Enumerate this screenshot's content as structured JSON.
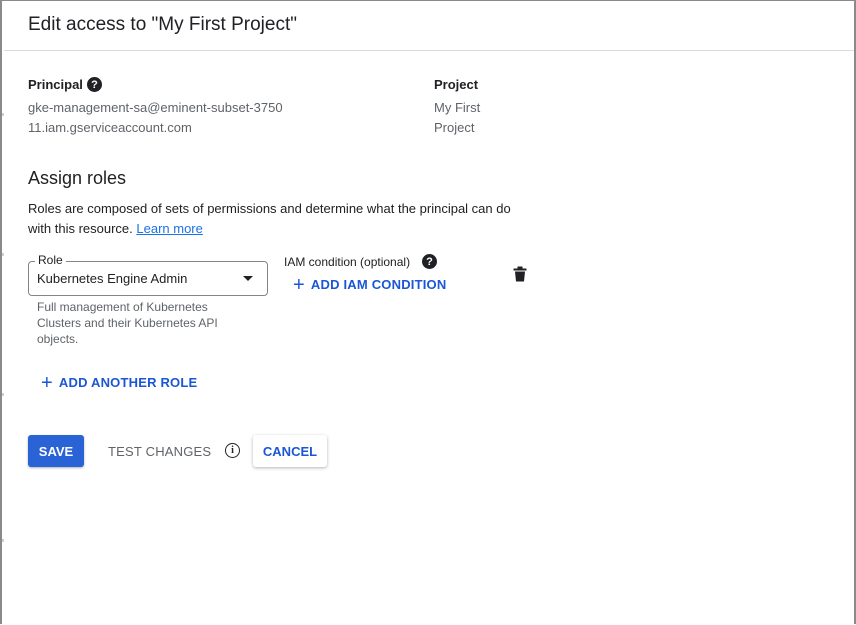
{
  "dialog": {
    "title": "Edit access to \"My First Project\""
  },
  "principal": {
    "label": "Principal",
    "help_icon": "help-circle-icon",
    "value": "gke-management-sa@eminent-subset-375011.iam.gserviceaccount.com"
  },
  "project": {
    "label": "Project",
    "value": "My First Project"
  },
  "assign_roles": {
    "title": "Assign roles",
    "description": "Roles are composed of sets of permissions and determine what the principal can do with this resource.",
    "learn_more": "Learn more"
  },
  "role": {
    "legend": "Role",
    "value": "Kubernetes Engine Admin",
    "hint": "Full management of Kubernetes Clusters and their Kubernetes API objects."
  },
  "iam_condition": {
    "label": "IAM condition (optional)",
    "add_label": "ADD IAM CONDITION"
  },
  "add_another_role": "ADD ANOTHER ROLE",
  "actions": {
    "save": "SAVE",
    "test_changes": "TEST CHANGES",
    "cancel": "CANCEL"
  },
  "colors": {
    "primary": "#2a63d6",
    "link": "#1a73e8",
    "accent_text": "#1a56d6"
  }
}
